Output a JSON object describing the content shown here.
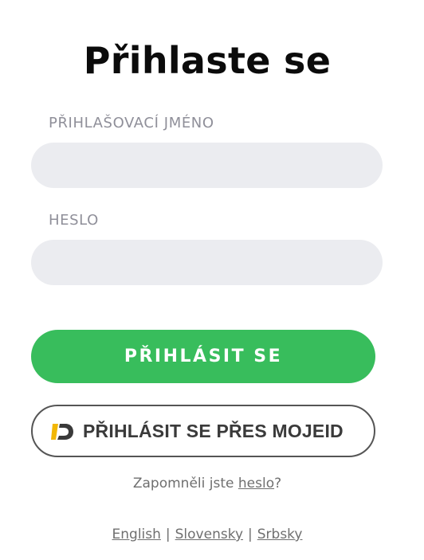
{
  "title": "Přihlaste se",
  "form": {
    "username_label": "PŘIHLAŠOVACÍ JMÉNO",
    "username_value": "",
    "password_label": "HESLO",
    "password_value": "",
    "login_button": "PŘIHLÁSIT SE",
    "mojeid_button": "PŘIHLÁSIT SE PŘES MOJEID",
    "mojeid_icon": "mojeid-logo-icon"
  },
  "forgot": {
    "prefix": "Zapomněli jste ",
    "link": "heslo",
    "suffix": "?"
  },
  "languages": {
    "items": [
      "English",
      "Slovensky",
      "Srbsky"
    ],
    "separator": "|"
  },
  "colors": {
    "primary": "#38bd5c",
    "input_bg": "#ebecf0",
    "label": "#8f8f99",
    "mojeid_yellow": "#f2b705"
  }
}
